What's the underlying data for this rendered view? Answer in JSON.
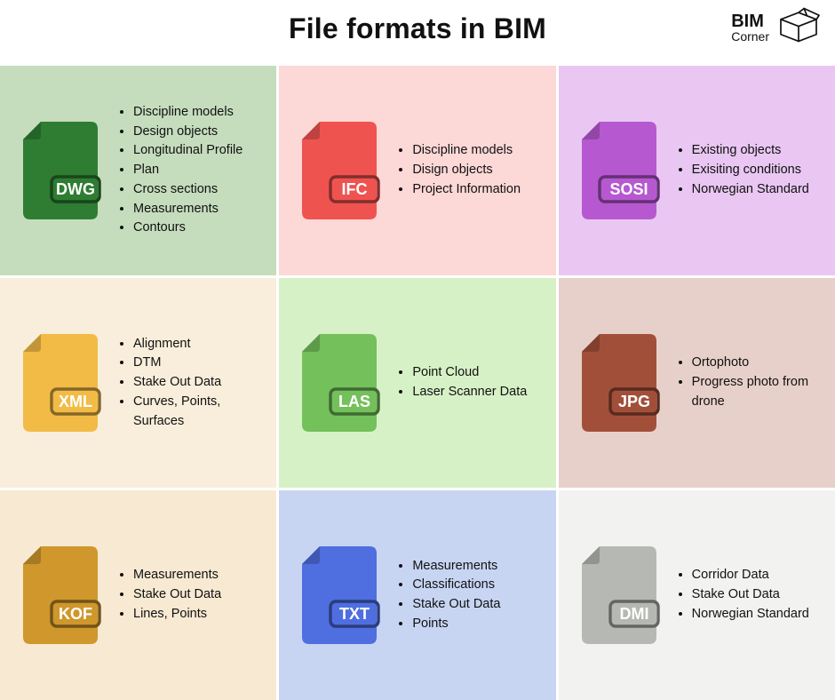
{
  "title": "File formats in BIM",
  "logo": {
    "line1": "BIM",
    "line2": "Corner"
  },
  "cards": [
    {
      "code": "DWG",
      "bg": "#c5ddbd",
      "icon": "#2e7d32",
      "items": [
        "Discipline models",
        "Design objects",
        "Longitudinal Profile",
        "Plan",
        "Cross sections",
        "Measurements",
        "Contours"
      ]
    },
    {
      "code": "IFC",
      "bg": "#fcd8d6",
      "icon": "#ef5350",
      "items": [
        "Discipline models",
        "Disign objects",
        "Project Information"
      ]
    },
    {
      "code": "SOSI",
      "bg": "#e9c7f2",
      "icon": "#b659d1",
      "items": [
        "Existing objects",
        "Exisiting conditions",
        "Norwegian Standard"
      ]
    },
    {
      "code": "XML",
      "bg": "#f8eedb",
      "icon": "#f2bb46",
      "items": [
        "Alignment",
        "DTM",
        "Stake Out Data",
        "Curves, Points, Surfaces"
      ]
    },
    {
      "code": "LAS",
      "bg": "#d7f1c6",
      "icon": "#74c05b",
      "items": [
        "Point Cloud",
        "Laser Scanner Data"
      ]
    },
    {
      "code": "JPG",
      "bg": "#e8d0ca",
      "icon": "#a24f3a",
      "items": [
        "Ortophoto",
        "Progress photo from drone"
      ]
    },
    {
      "code": "KOF",
      "bg": "#f7e9d2",
      "icon": "#cf972c",
      "items": [
        "Measurements",
        "Stake Out Data",
        "Lines, Points"
      ]
    },
    {
      "code": "TXT",
      "bg": "#c7d5f2",
      "icon": "#4f6ee0",
      "items": [
        "Measurements",
        "Classifications",
        "Stake Out Data",
        "Points"
      ]
    },
    {
      "code": "DMI",
      "bg": "#f2f3f1",
      "icon": "#b6b9b3",
      "items": [
        "Corridor Data",
        "Stake Out Data",
        "Norwegian Standard"
      ]
    }
  ]
}
